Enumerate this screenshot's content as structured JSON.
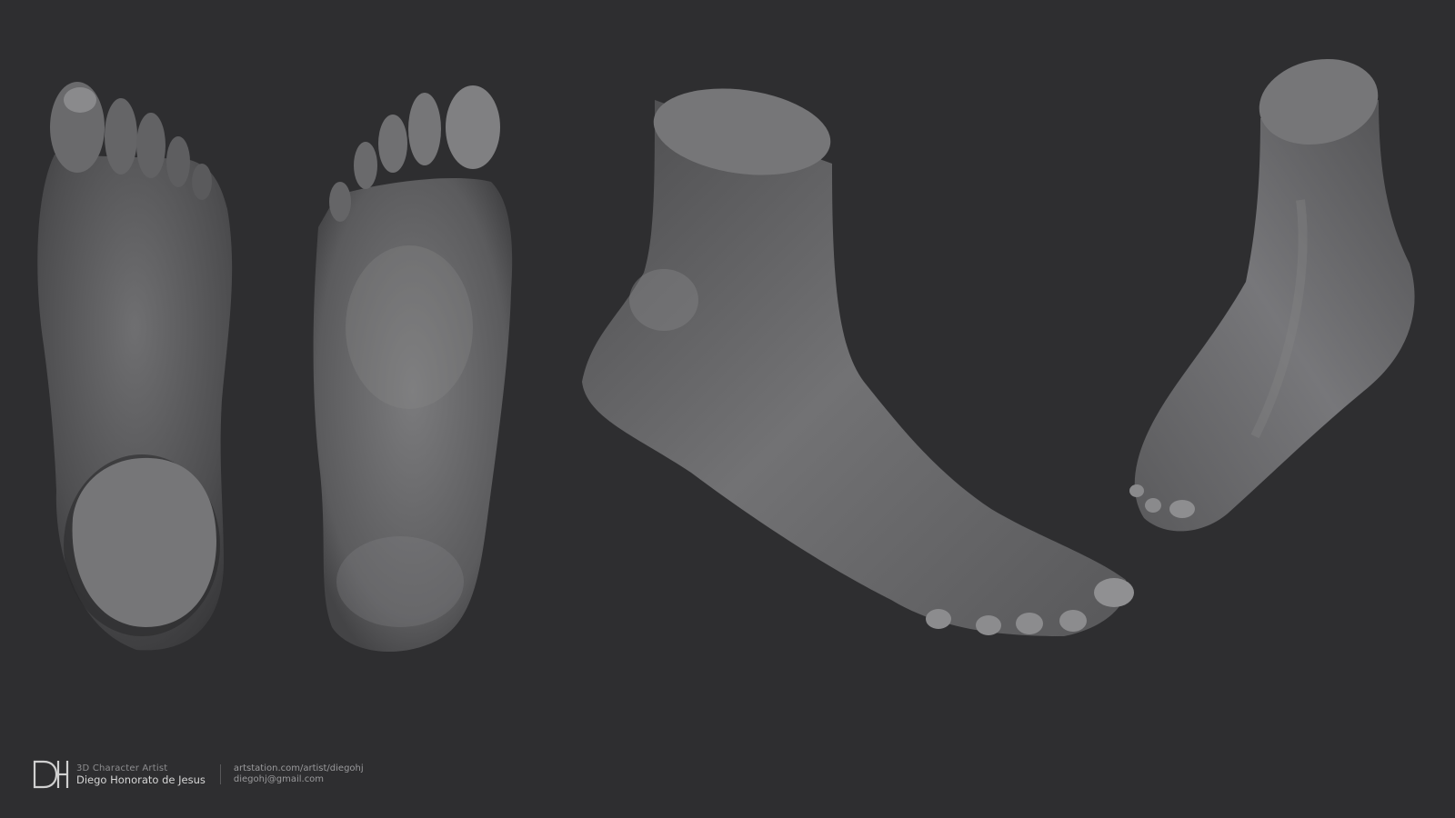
{
  "scene": {
    "background": "#2e2e30",
    "views": [
      {
        "name": "foot-top-view"
      },
      {
        "name": "foot-sole-view"
      },
      {
        "name": "foot-side-view"
      },
      {
        "name": "foot-front-three-quarter-view"
      }
    ],
    "model_color": "#7a7a7c",
    "cut_color": "#767678"
  },
  "footer": {
    "logo_letters": "DH",
    "role": "3D Character Artist",
    "name": "Diego Honorato de Jesus",
    "website": "artstation.com/artist/diegohj",
    "email": "diegohj@gmail.com"
  }
}
